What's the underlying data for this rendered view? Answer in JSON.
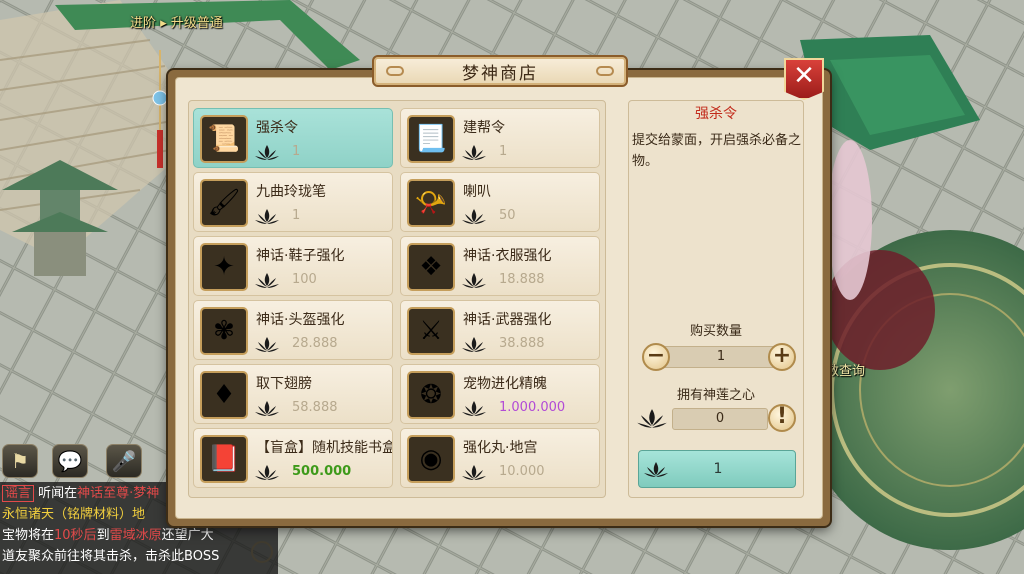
{
  "hud": {
    "top_banner": "进阶 ▸ 升级普通",
    "right_label": "数查询",
    "chat_icon": "chat-bubble-icon",
    "voice_icon": "microphone-icon"
  },
  "chat": {
    "lines": [
      {
        "parts": [
          {
            "t": "谣言",
            "c": "#e24a4a"
          },
          {
            "t": " 听闻在",
            "c": "#ffffff"
          },
          {
            "t": "神话至尊·梦神",
            "c": "#e24a4a"
          }
        ]
      },
      {
        "parts": [
          {
            "t": "永恒诸天（铭牌材料）地",
            "c": "#f3d03e"
          }
        ]
      },
      {
        "parts": [
          {
            "t": "宝物将在",
            "c": "#ffffff"
          },
          {
            "t": "10秒后",
            "c": "#e24a4a"
          },
          {
            "t": "到",
            "c": "#ffffff"
          },
          {
            "t": "雷域冰原",
            "c": "#e24a4a"
          },
          {
            "t": "还望广大",
            "c": "#ffffff"
          }
        ]
      },
      {
        "parts": [
          {
            "t": "道友聚众前往将其击杀，击杀此BOSS",
            "c": "#ffffff"
          }
        ]
      }
    ]
  },
  "shop": {
    "title": "梦神商店",
    "close_icon": "close-x-icon",
    "currency_icon": "black-lotus-icon",
    "items": [
      {
        "name": "强杀令",
        "price": "1",
        "icon": "scroll-token-icon",
        "glyph": "📜",
        "price_style": "",
        "selected": true
      },
      {
        "name": "建帮令",
        "price": "1",
        "icon": "golden-scroll-icon",
        "glyph": "📃",
        "price_style": "",
        "selected": false
      },
      {
        "name": "九曲玲珑笔",
        "price": "1",
        "icon": "jade-brush-icon",
        "glyph": "🖌",
        "price_style": "",
        "selected": false
      },
      {
        "name": "喇叭",
        "price": "50",
        "icon": "gold-horn-icon",
        "glyph": "📯",
        "price_style": "",
        "selected": false
      },
      {
        "name": "神话·鞋子强化",
        "price": "100",
        "icon": "green-wind-boots-icon",
        "glyph": "✦",
        "price_style": "",
        "selected": false
      },
      {
        "name": "神话·衣服强化",
        "price": "18.888",
        "icon": "armor-figure-icon",
        "glyph": "❖",
        "price_style": "",
        "selected": false
      },
      {
        "name": "神话·头盔强化",
        "price": "28.888",
        "icon": "winged-helmet-icon",
        "glyph": "✾",
        "price_style": "",
        "selected": false
      },
      {
        "name": "神话·武器强化",
        "price": "38.888",
        "icon": "golden-sword-icon",
        "glyph": "⚔",
        "price_style": "",
        "selected": false
      },
      {
        "name": "取下翅膀",
        "price": "58.888",
        "icon": "red-gem-icon",
        "glyph": "♦",
        "price_style": "",
        "selected": false
      },
      {
        "name": "宠物进化精魄",
        "price": "1.000.000",
        "icon": "pet-essence-scroll-icon",
        "glyph": "❂",
        "price_style": "purple",
        "selected": false
      },
      {
        "name": "【盲盒】随机技能书盒",
        "price": "500.000",
        "icon": "skill-book-box-icon",
        "glyph": "📕",
        "price_style": "green",
        "selected": false
      },
      {
        "name": "强化丸·地宫",
        "price": "10.000",
        "icon": "orange-orb-icon",
        "glyph": "◉",
        "price_style": "",
        "selected": false
      }
    ],
    "detail": {
      "title": "强杀令",
      "description": "提交给蒙面，开启强杀必备之物。",
      "qty_label": "购买数量",
      "qty_value": "1",
      "minus_label": "−",
      "plus_label": "+",
      "own_label": "拥有神莲之心",
      "own_value": "0",
      "info_label": "!",
      "buy_total": "1"
    }
  }
}
